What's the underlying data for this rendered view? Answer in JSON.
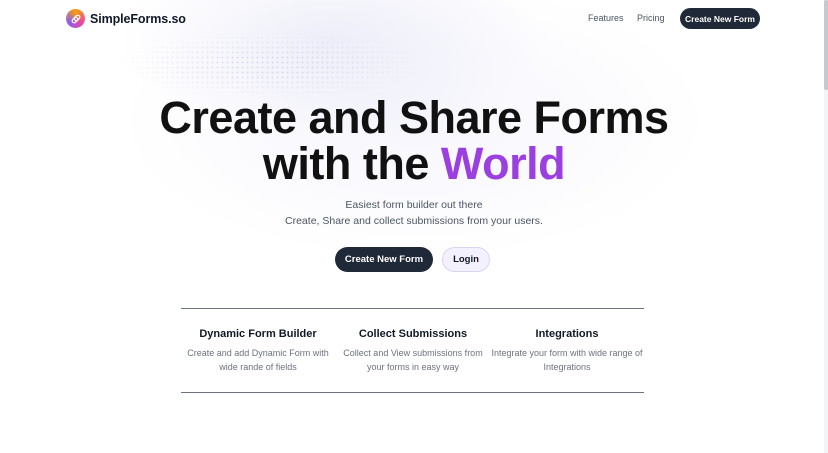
{
  "header": {
    "brand_name": "SimpleForms.so",
    "logo_icon": "link-icon",
    "nav": [
      {
        "label": "Features"
      },
      {
        "label": "Pricing"
      }
    ],
    "cta_label": "Create New Form"
  },
  "hero": {
    "title_line1": "Create and Share Forms",
    "title_line2_prefix": "with the",
    "title_line2_accent": "World",
    "subtitle_line1": "Easiest form builder out there",
    "subtitle_line2": "Create, Share and collect submissions from your users.",
    "primary_cta": "Create New Form",
    "secondary_cta": "Login"
  },
  "features": [
    {
      "title": "Dynamic Form Builder",
      "desc_line1": "Create and add Dynamic Form with",
      "desc_line2": "wide rande of fields"
    },
    {
      "title": "Collect Submissions",
      "desc_line1": "Collect and View submissions from",
      "desc_line2": "your forms in easy way"
    },
    {
      "title": "Integrations",
      "desc_line1": "Integrate your form with wide range of",
      "desc_line2": "Integrations"
    }
  ],
  "colors": {
    "accent": "#9b3fe0",
    "button_dark": "#1f2937",
    "login_bg": "#f3f1fd"
  }
}
